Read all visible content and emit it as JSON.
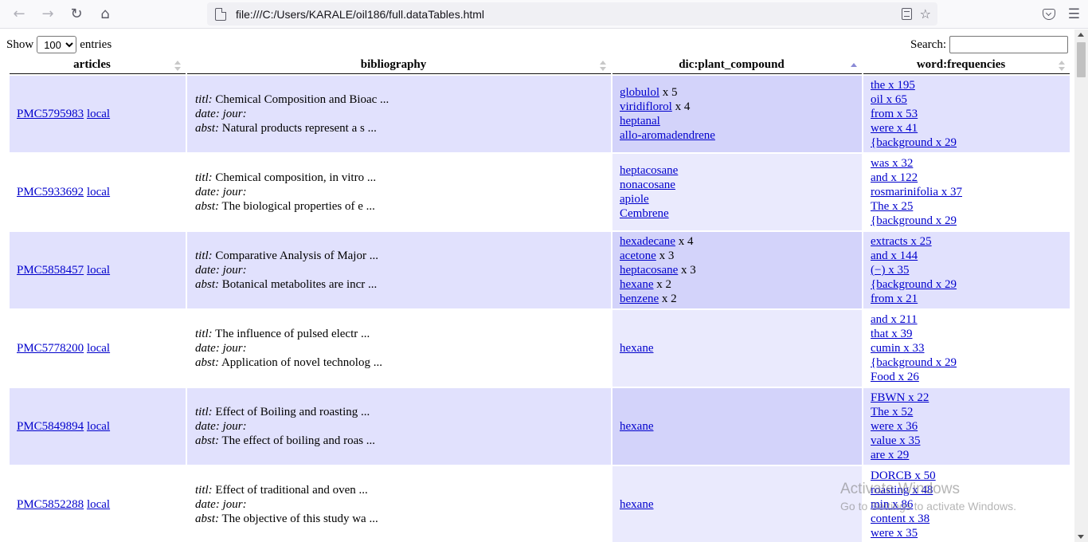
{
  "browser": {
    "url": "file:///C:/Users/KARALE/oil186/full.dataTables.html",
    "icons": [
      "back-icon",
      "forward-icon",
      "reload-icon",
      "home-icon",
      "page-icon",
      "reader-view-icon",
      "bookmark-star-icon",
      "pocket-icon",
      "menu-icon"
    ]
  },
  "controls": {
    "show_label": "Show",
    "entries_value": "100",
    "entries_label": "entries",
    "search_label": "Search:",
    "search_value": ""
  },
  "table": {
    "headers": [
      "articles",
      "bibliography",
      "dic:plant_compound",
      "word:frequencies"
    ],
    "sorted_column": "dic:plant_compound",
    "rows": [
      {
        "pmc": "PMC5795983",
        "local": "local",
        "titl": "Chemical Composition and Bioac ...",
        "date": "",
        "abst": "Natural products represent a s ...",
        "compounds": [
          {
            "link": "globulol",
            "count": " x 5"
          },
          {
            "link": "viridiflorol",
            "count": " x 4"
          },
          {
            "link": "heptanal",
            "count": ""
          },
          {
            "link": "allo-aromadendrene",
            "count": ""
          }
        ],
        "words": [
          "the x 195",
          "oil x 65",
          "from x 53",
          "were x 41",
          "{background x 29"
        ]
      },
      {
        "pmc": "PMC5933692",
        "local": "local",
        "titl": "Chemical composition, in vitro ...",
        "date": "",
        "abst": "The biological properties of e ...",
        "compounds": [
          {
            "link": "heptacosane",
            "count": ""
          },
          {
            "link": "nonacosane",
            "count": ""
          },
          {
            "link": "apiole",
            "count": ""
          },
          {
            "link": "Cembrene",
            "count": ""
          }
        ],
        "words": [
          "was x 32",
          "and x 122",
          "rosmarinifolia x 37",
          "The x 25",
          "{background x 29"
        ]
      },
      {
        "pmc": "PMC5858457",
        "local": "local",
        "titl": "Comparative Analysis of Major ...",
        "date": "",
        "abst": "Botanical metabolites are incr ...",
        "compounds": [
          {
            "link": "hexadecane",
            "count": " x 4"
          },
          {
            "link": "acetone",
            "count": " x 3"
          },
          {
            "link": "heptacosane",
            "count": " x 3"
          },
          {
            "link": "hexane",
            "count": " x 2"
          },
          {
            "link": "benzene",
            "count": " x 2"
          }
        ],
        "words": [
          "extracts x 25",
          "and x 144",
          "(−) x 35",
          "{background x 29",
          "from x 21"
        ]
      },
      {
        "pmc": "PMC5778200",
        "local": "local",
        "titl": "The influence of pulsed electr ...",
        "date": "",
        "abst": "Application of novel technolog ...",
        "compounds": [
          {
            "link": "hexane",
            "count": ""
          }
        ],
        "words": [
          "and x 211",
          "that x 39",
          "cumin x 33",
          "{background x 29",
          "Food x 26"
        ]
      },
      {
        "pmc": "PMC5849894",
        "local": "local",
        "titl": "Effect of Boiling and roasting ...",
        "date": "",
        "abst": "The effect of boiling and roas ...",
        "compounds": [
          {
            "link": "hexane",
            "count": ""
          }
        ],
        "words": [
          "FBWN x 22",
          "The x 52",
          "were x 36",
          "value x 35",
          "are x 29"
        ]
      },
      {
        "pmc": "PMC5852288",
        "local": "local",
        "titl": "Effect of traditional and oven ...",
        "date": "",
        "abst": "The objective of this study wa ...",
        "compounds": [
          {
            "link": "hexane",
            "count": ""
          }
        ],
        "words": [
          "DORCB x 50",
          "roasting x 48",
          "min x 86",
          "content x 38",
          "were x 35"
        ]
      }
    ]
  },
  "watermark": {
    "line1": "Activate Windows",
    "line2": "Go to Settings to activate Windows."
  }
}
